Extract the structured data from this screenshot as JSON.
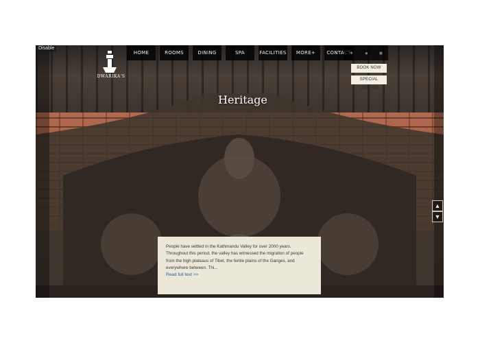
{
  "disable_label": "Disable",
  "logo": {
    "text": "DWARIKA'S",
    "icon": "logo-emblem-icon"
  },
  "nav": {
    "items": [
      "HOME",
      "ROOMS",
      "DINING",
      "SPA",
      "FACILITIES",
      "MORE+",
      "CONTACT"
    ]
  },
  "social": {
    "icons": [
      "twitter-icon",
      "pinterest-icon",
      "social-icon"
    ]
  },
  "cta": {
    "book_now": "BOOK NOW",
    "special_offers": "SPECIAL OFFERS"
  },
  "hero": {
    "heading": "Heritage"
  },
  "card": {
    "text": "People have settled in the Kathmandu Valley for over 2000 years. Throughout this period, the valley has witnessed the migration of people from the high plateaus of Tibet, the fertile plains of the Ganges, and everywhere between. Thi...",
    "link": "Read full text >>"
  },
  "colors": {
    "card_bg": "#ebe7d9",
    "link": "#2d5b9a",
    "nav_bg": "#000000"
  },
  "arrows": {
    "up": "▲",
    "down": "▼"
  }
}
